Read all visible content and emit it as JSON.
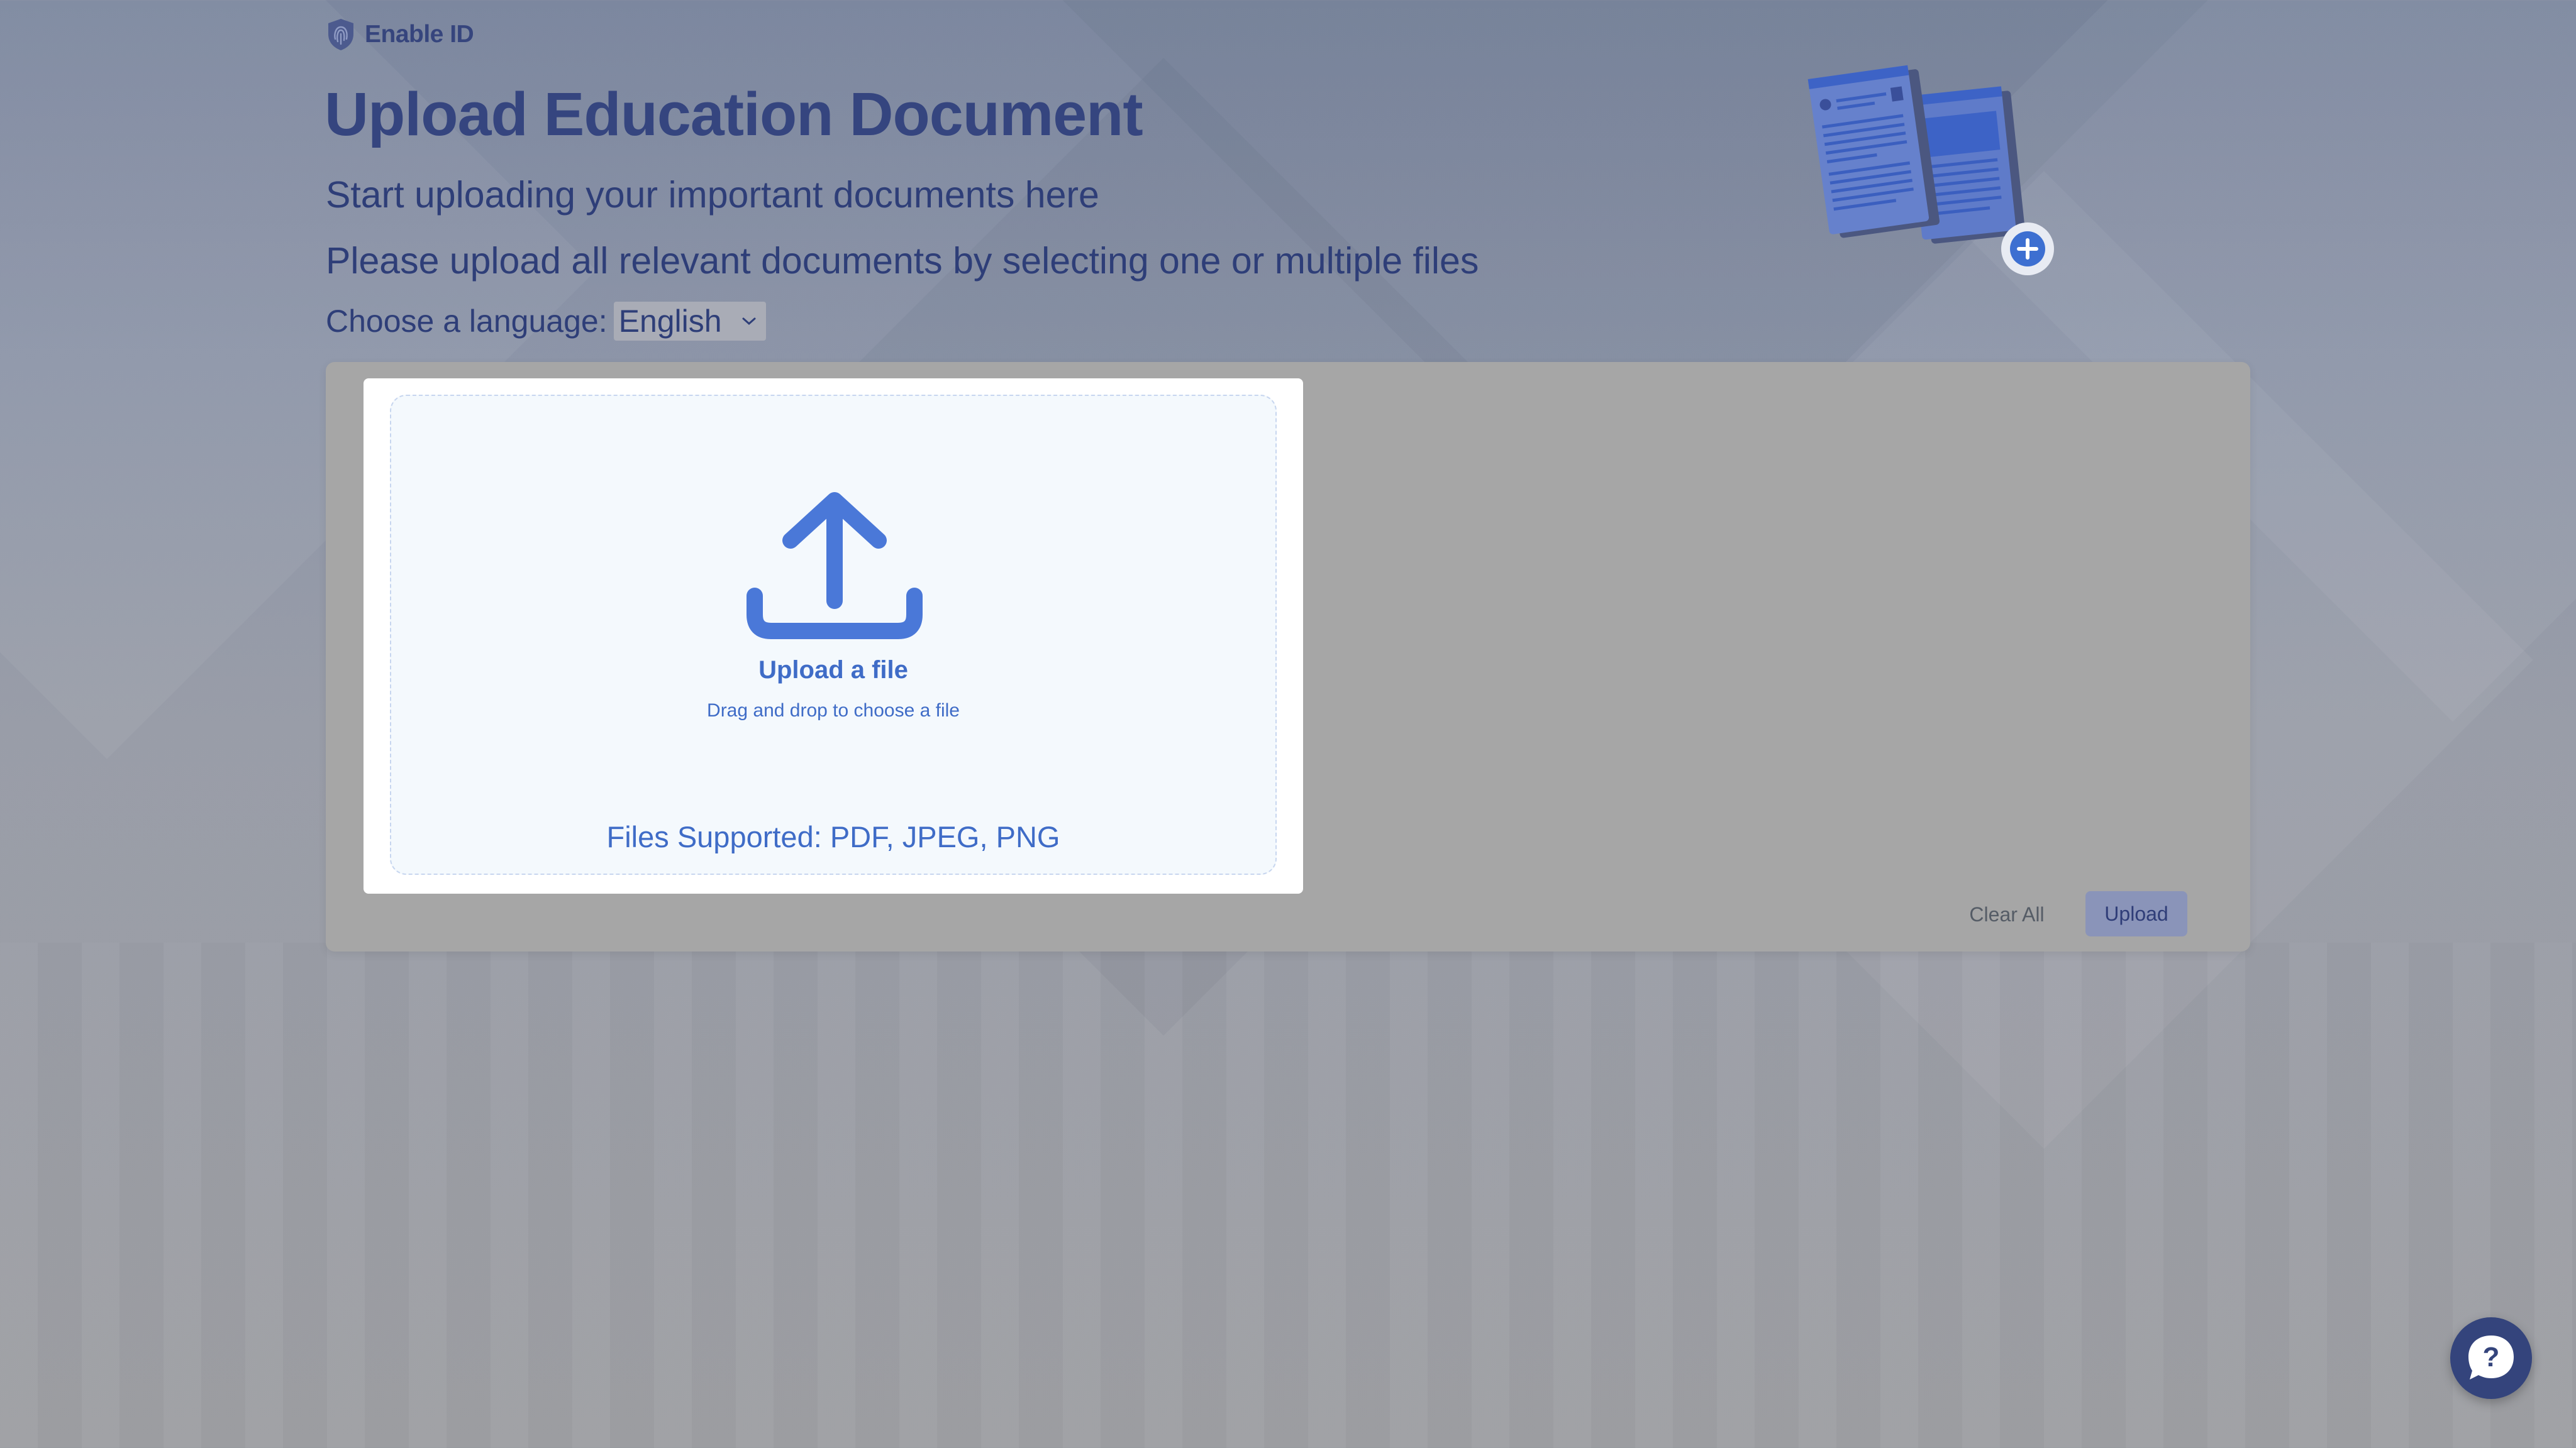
{
  "brand": {
    "name": "Enable ID",
    "logo_icon": "fingerprint-shield-icon"
  },
  "page": {
    "title": "Upload Education Document",
    "subtitle": "Start uploading your important documents here",
    "instruction": "Please upload all relevant documents by selecting one or multiple files"
  },
  "language": {
    "label": "Choose a language:",
    "selected": "English"
  },
  "hero": {
    "icon": "documents-add-illustration"
  },
  "dropzone": {
    "title": "Upload a file",
    "subtitle": "Drag and drop to choose a file",
    "supported": "Files Supported: PDF, JPEG, PNG",
    "icon": "upload-arrow-icon"
  },
  "actions": {
    "clear_label": "Clear All",
    "upload_label": "Upload"
  },
  "help": {
    "icon": "question-chat-icon",
    "glyph": "?"
  },
  "colors": {
    "primary_text": "#35457f",
    "accent_blue": "#3f6cc7",
    "panel_bg": "#a6a6a6",
    "upload_button": "#8a94b9",
    "help_button": "#34447c"
  }
}
